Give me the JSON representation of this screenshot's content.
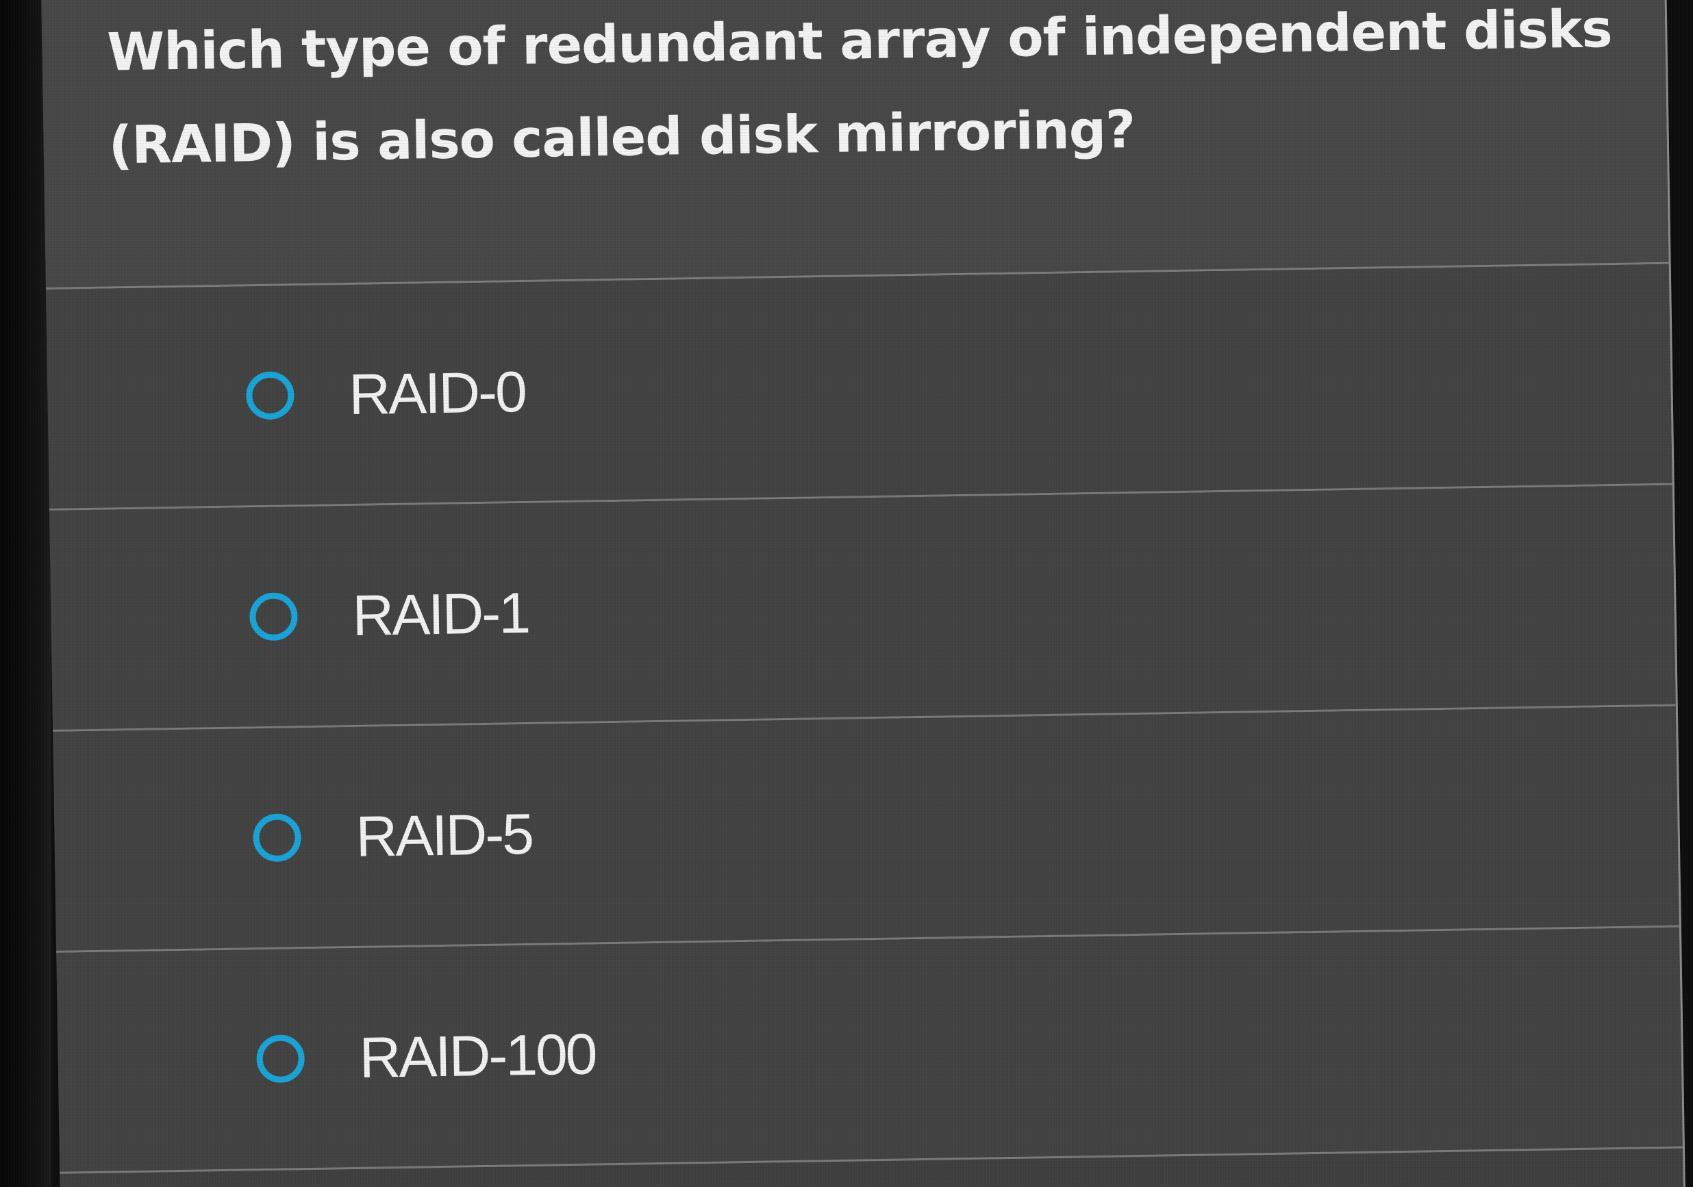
{
  "question": {
    "text": "Which type of redundant array of independent disks (RAID) is also called disk mirroring?"
  },
  "options": [
    {
      "label": "RAID-0",
      "selected": false
    },
    {
      "label": "RAID-1",
      "selected": false
    },
    {
      "label": "RAID-5",
      "selected": false
    },
    {
      "label": "RAID-100",
      "selected": false
    }
  ],
  "colors": {
    "radio_accent": "#1aa3d6",
    "panel_background": "#424242",
    "text": "#f0f0f0"
  }
}
